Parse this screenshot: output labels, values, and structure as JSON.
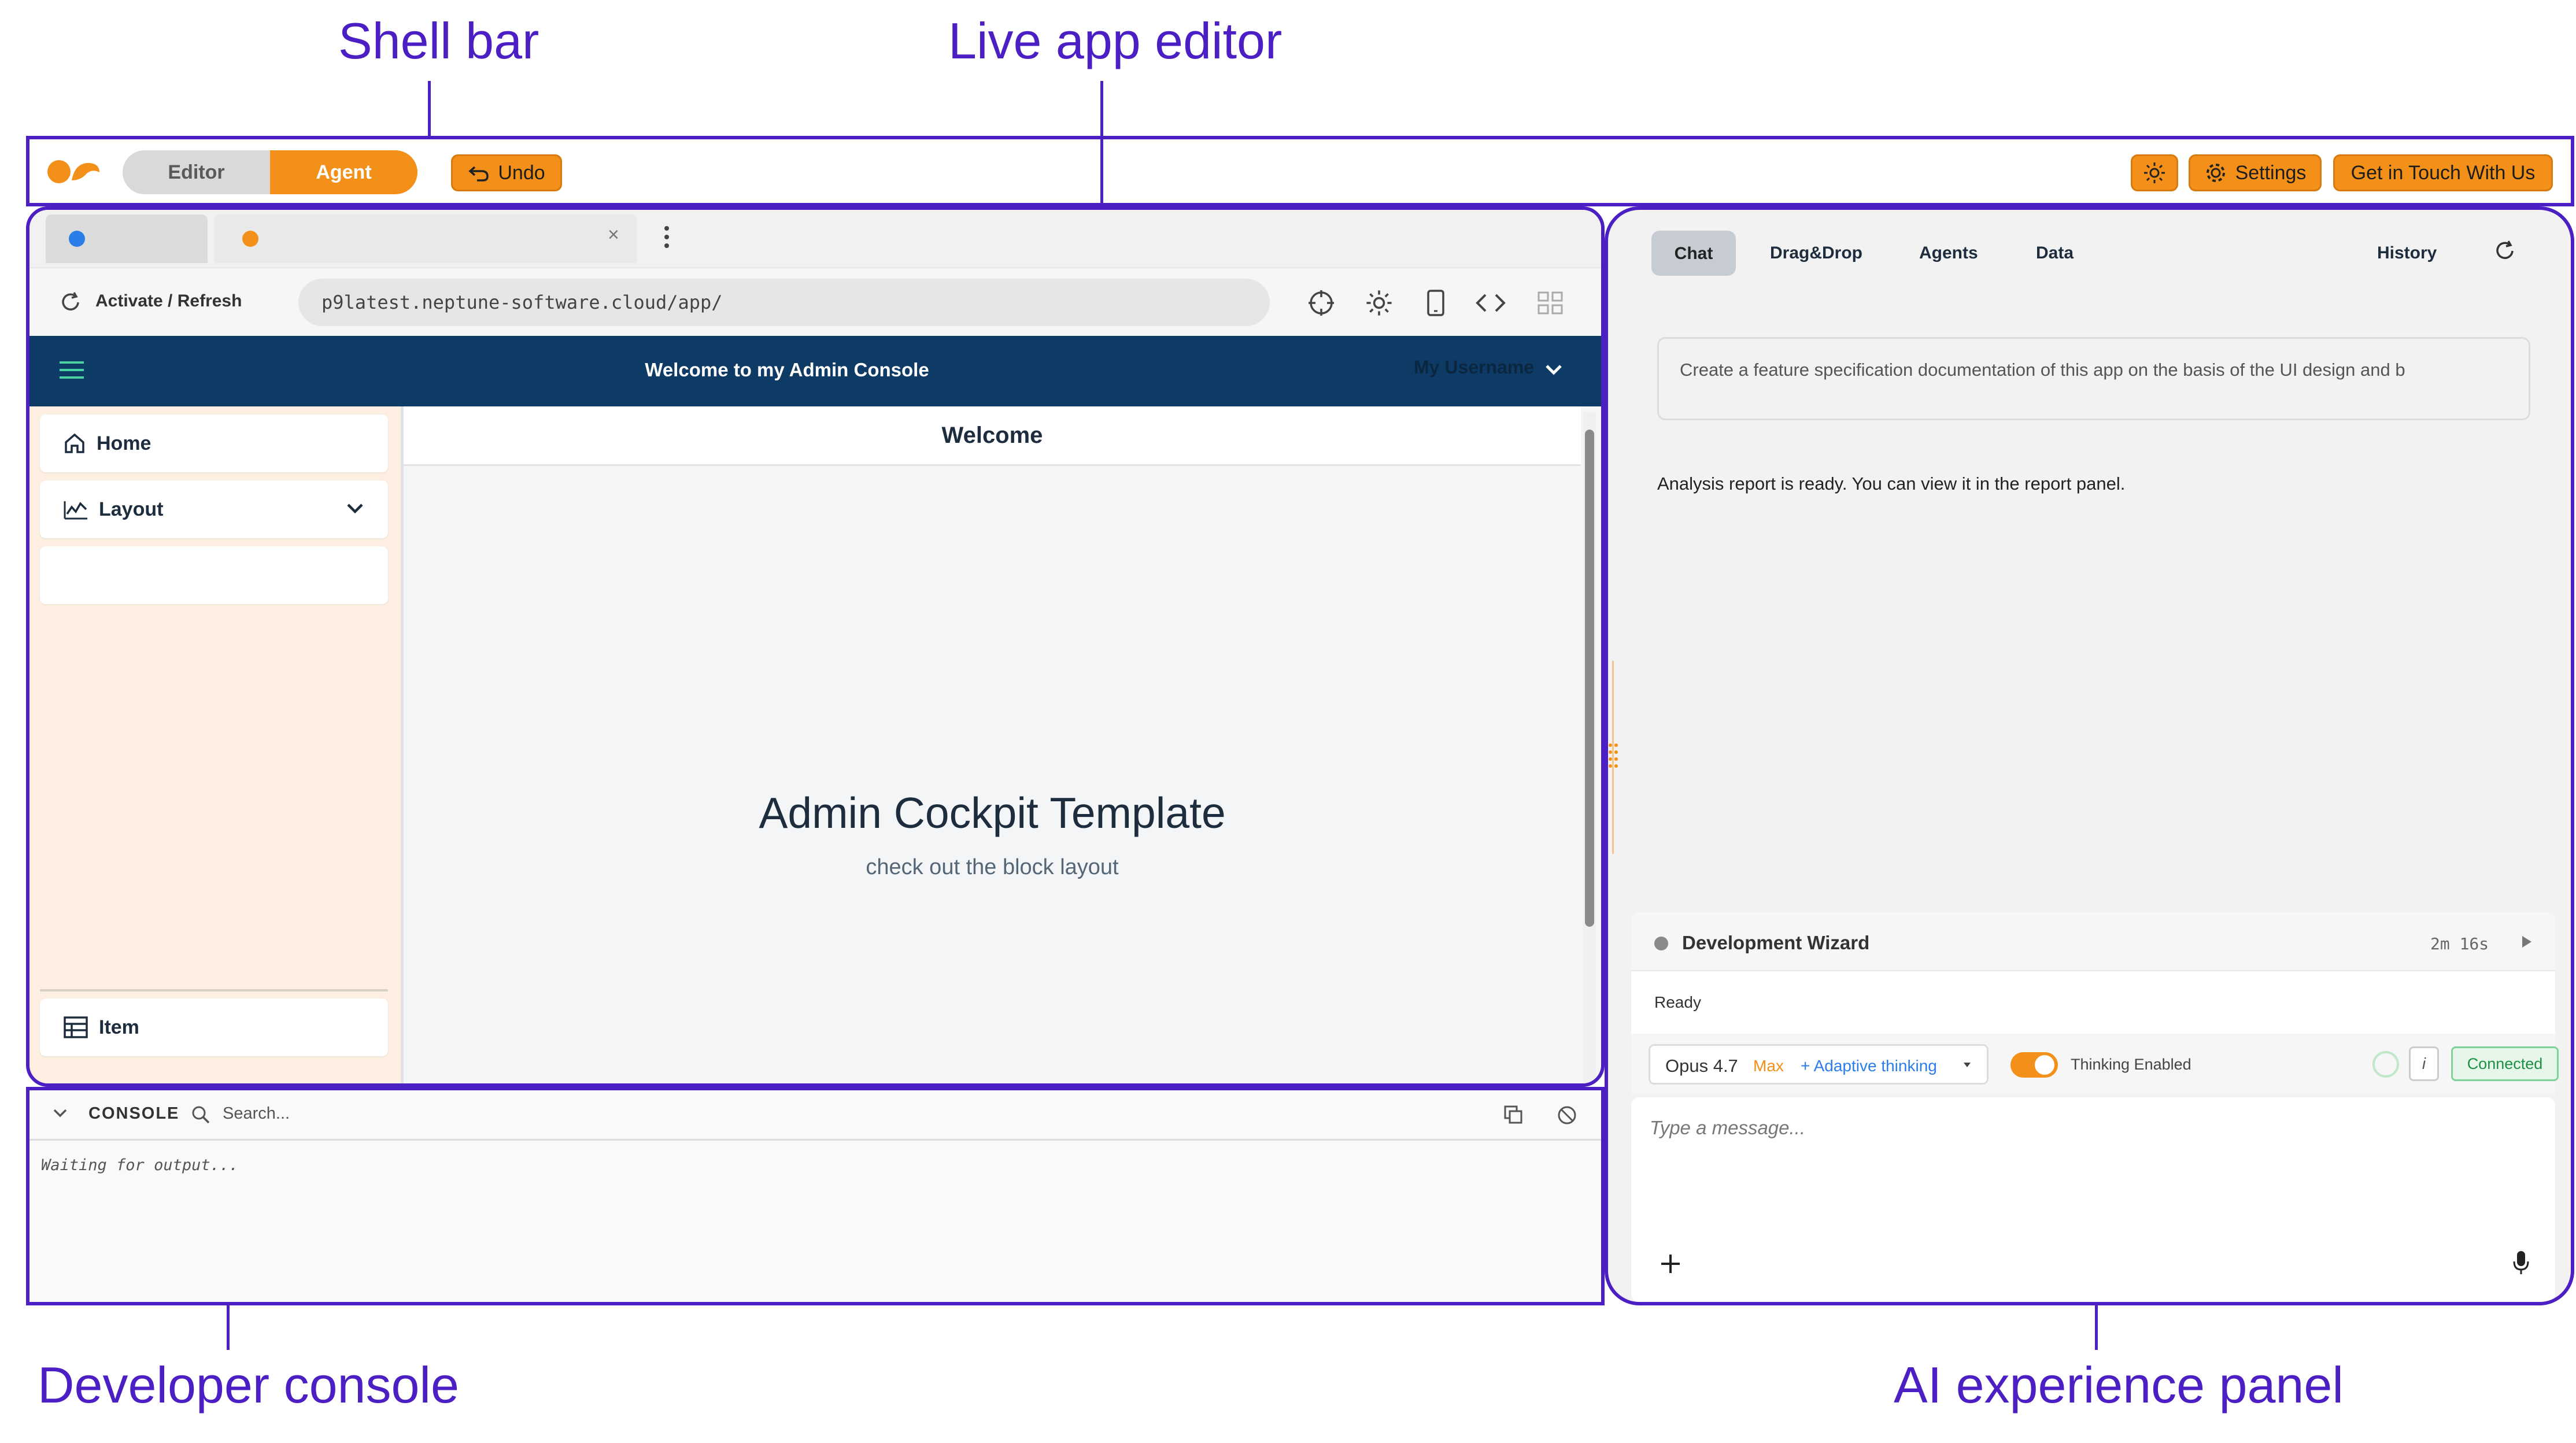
{
  "callouts": {
    "shell_bar": "Shell bar",
    "live_app_editor": "Live app editor",
    "developer_console": "Developer console",
    "ai_experience_panel": "AI experience panel"
  },
  "shell": {
    "mode_editor": "Editor",
    "mode_agent": "Agent",
    "undo": "Undo",
    "settings": "Settings",
    "contact": "Get in Touch With Us"
  },
  "browser": {
    "tab_close": "×",
    "refresh_label": "Activate / Refresh",
    "url": "p9latest.neptune-software.cloud/app/"
  },
  "app": {
    "header_title": "Welcome to my Admin Console",
    "username": "My Username",
    "nav": [
      {
        "label": "Home"
      },
      {
        "label": "Layout"
      },
      {
        "label": "Item"
      }
    ],
    "page_title": "Welcome",
    "hero_title": "Admin Cockpit Template",
    "hero_subtitle": "check out the block layout"
  },
  "console": {
    "label": "CONSOLE",
    "search_placeholder": "Search...",
    "output": "Waiting for output..."
  },
  "ai": {
    "tabs": [
      "Chat",
      "Drag&Drop",
      "Agents",
      "Data"
    ],
    "history": "History",
    "prompt": "Create a feature specification documentation of this app on the basis of the UI design and b",
    "response": "Analysis report is ready. You can view it in the report panel.",
    "wizard_title": "Development Wizard",
    "wizard_time": "2m 16s",
    "wizard_status": "Ready",
    "model": "Opus 4.7",
    "model_tier": "Max",
    "adaptive": "+ Adaptive thinking",
    "thinking": "Thinking Enabled",
    "info": "i",
    "connected": "Connected",
    "message_placeholder": "Type a message..."
  },
  "colors": {
    "accent": "#f39019",
    "annotation": "#4b1fc4",
    "app_header": "#0e3a66",
    "sidebar": "#fdefe2"
  }
}
